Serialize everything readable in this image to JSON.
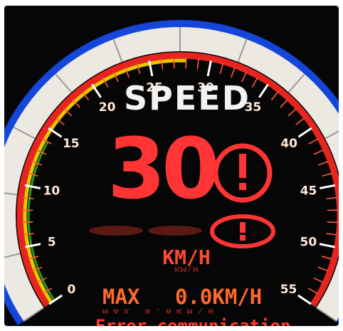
{
  "display": {
    "title": "SPEED",
    "speed_value": "30",
    "unit": "KM/H",
    "unit_reflection": "KM\\H",
    "max_label": "MAX",
    "max_value": "0.0KM/H",
    "max_reflection": "MAX 0.0KM\\H",
    "error_message": "Error communication",
    "warning_icon_1": "exclamation-circle-icon",
    "warning_icon_2": "exclamation-oval-icon"
  },
  "gauge": {
    "min": 0,
    "max": 55,
    "current_speed": 30,
    "tick_labels": [
      "0",
      "5",
      "10",
      "15",
      "20",
      "25",
      "30",
      "35",
      "40",
      "45",
      "50",
      "55"
    ]
  },
  "colors": {
    "background": "#060606",
    "speed_value": "#ff3535",
    "title": "#f2f2f2",
    "red_arc": "#e8241e",
    "yellow_arc": "#f7d100",
    "blue_rim": "#1446d9",
    "bezel": "#ece9e2"
  }
}
